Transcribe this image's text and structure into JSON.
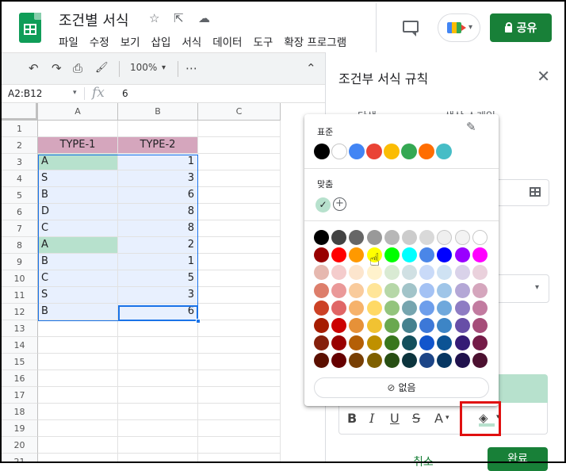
{
  "header": {
    "doc_title": "조건별 서식",
    "menu": [
      "파일",
      "수정",
      "보기",
      "삽입",
      "서식",
      "데이터",
      "도구",
      "확장 프로그램"
    ],
    "share_label": "공유"
  },
  "toolbar": {
    "zoom": "100%"
  },
  "formula_bar": {
    "name_box": "A2:B12",
    "fx": "fx",
    "value": "6"
  },
  "grid": {
    "columns": [
      "A",
      "B",
      "C"
    ],
    "rows": [
      "1",
      "2",
      "3",
      "4",
      "5",
      "6",
      "7",
      "8",
      "9",
      "10",
      "11",
      "12",
      "13",
      "14",
      "15",
      "16",
      "17",
      "18",
      "19",
      "20",
      "21"
    ],
    "header_row": [
      "TYPE-1",
      "TYPE-2"
    ],
    "data": [
      [
        "A",
        "1"
      ],
      [
        "S",
        "3"
      ],
      [
        "B",
        "6"
      ],
      [
        "D",
        "8"
      ],
      [
        "C",
        "8"
      ],
      [
        "A",
        "2"
      ],
      [
        "B",
        "1"
      ],
      [
        "C",
        "5"
      ],
      [
        "S",
        "3"
      ],
      [
        "B",
        "6"
      ]
    ],
    "highlighted_rows": [
      0,
      5
    ],
    "colors": {
      "header_fill": "#d5a6bd",
      "highlight_fill": "#b7e1cd",
      "selection_fill": "#e8f0fe"
    }
  },
  "panel": {
    "title": "조건부 서식 규칙",
    "tab_single": "단색",
    "tab_scale": "색상 스케일",
    "cancel_label": "취소",
    "done_label": "완료",
    "format_buttons": [
      "B",
      "I",
      "U",
      "S",
      "A"
    ]
  },
  "picker": {
    "standard_label": "표준",
    "custom_label": "맞춤",
    "none_label": "없음",
    "standard_colors": [
      "#000000",
      "#ffffff",
      "#4285f4",
      "#ea4335",
      "#fbbc04",
      "#34a853",
      "#ff6d01",
      "#46bdc6"
    ],
    "custom_colors": [
      "#b7e1cd"
    ],
    "palette": [
      [
        "#000000",
        "#434343",
        "#666666",
        "#999999",
        "#b7b7b7",
        "#cccccc",
        "#d9d9d9",
        "#efefef",
        "#f3f3f3",
        "#ffffff"
      ],
      [
        "#980000",
        "#ff0000",
        "#ff9900",
        "#ffff00",
        "#00ff00",
        "#00ffff",
        "#4a86e8",
        "#0000ff",
        "#9900ff",
        "#ff00ff"
      ],
      [
        "#e6b8af",
        "#f4cccc",
        "#fce5cd",
        "#fff2cc",
        "#d9ead3",
        "#d0e0e3",
        "#c9daf8",
        "#cfe2f3",
        "#d9d2e9",
        "#ead1dc"
      ],
      [
        "#dd7e6b",
        "#ea9999",
        "#f9cb9c",
        "#ffe599",
        "#b6d7a8",
        "#a2c4c9",
        "#a4c2f4",
        "#9fc5e8",
        "#b4a7d6",
        "#d5a6bd"
      ],
      [
        "#cc4125",
        "#e06666",
        "#f6b26b",
        "#ffd966",
        "#93c47d",
        "#76a5af",
        "#6d9eeb",
        "#6fa8dc",
        "#8e7cc3",
        "#c27ba0"
      ],
      [
        "#a61c00",
        "#cc0000",
        "#e69138",
        "#f1c232",
        "#6aa84f",
        "#45818e",
        "#3c78d8",
        "#3d85c6",
        "#674ea7",
        "#a64d79"
      ],
      [
        "#85200c",
        "#990000",
        "#b45f06",
        "#bf9000",
        "#38761d",
        "#134f5c",
        "#1155cc",
        "#0b5394",
        "#351c75",
        "#741b47"
      ],
      [
        "#5b0f00",
        "#660000",
        "#783f04",
        "#7f6000",
        "#274e13",
        "#0c343d",
        "#1c4587",
        "#073763",
        "#20124d",
        "#4c1130"
      ]
    ]
  },
  "icons": {
    "star": "☆",
    "move": "⇱",
    "cloud": "☁",
    "undo": "↶",
    "redo": "↷",
    "print": "⎙",
    "paint": "🖌",
    "more": "⋯",
    "collapse": "⌃",
    "close": "✕",
    "pencil": "✎",
    "check": "✓",
    "plus": "+",
    "cursor": "☝",
    "bucket": "◈",
    "caret": "▾",
    "no_fill": "⊘"
  }
}
